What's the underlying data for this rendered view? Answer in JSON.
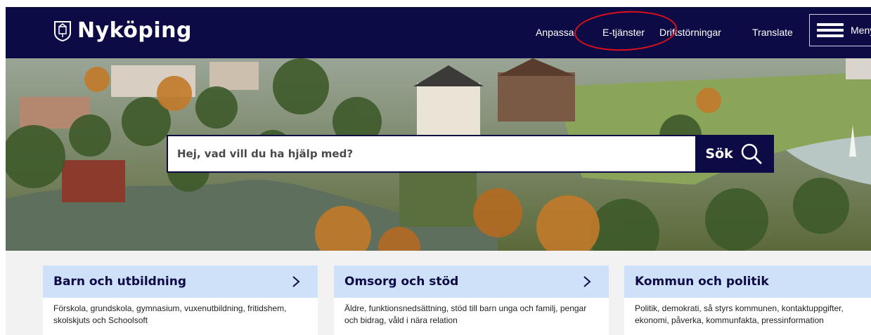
{
  "header": {
    "logo_text": "Nyköping",
    "nav": [
      "Anpassa",
      "E-tjänster",
      "Driftstörningar",
      "Translate"
    ],
    "menu_label": "Meny",
    "background_color": "#0d0b46"
  },
  "annotation": {
    "color": "#e0101a",
    "target": "E-tjänster"
  },
  "search": {
    "placeholder": "Hej, vad vill du ha hjälp med?",
    "button_label": "Sök",
    "icon": "search-icon"
  },
  "cards": [
    {
      "title": "Barn och utbildning",
      "description": "Förskola, grundskola, gymnasium, vuxenutbildning, fritidshem, skolskjuts och Schoolsoft"
    },
    {
      "title": "Omsorg och stöd",
      "description": "Äldre, funktionsnedsättning, stöd till barn unga och familj, pengar och bidrag, våld i nära relation"
    },
    {
      "title": "Kommun och politik",
      "description": "Politik, demokrati, så styrs kommunen, kontaktuppgifter, ekonomi, påverka, kommunfakta, pressinformation"
    }
  ],
  "colors": {
    "card_header": "#cfe0f9",
    "accent": "#0d0b46"
  }
}
